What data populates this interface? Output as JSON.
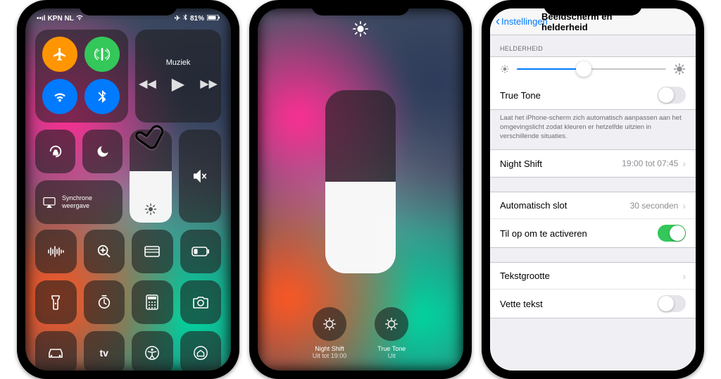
{
  "statusBar": {
    "carrier": "KPN NL",
    "battery": "81%"
  },
  "controlCenter": {
    "musicLabel": "Muziek",
    "syncLabel": "Synchrone weergave",
    "brightnessSliderPercent": 55
  },
  "brightnessPanel": {
    "sliderPercent": 50,
    "nightShift": {
      "title": "Night Shift",
      "subtitle": "Uit tot 19:00"
    },
    "trueTone": {
      "title": "True Tone",
      "subtitle": "Uit"
    }
  },
  "settings": {
    "backLabel": "Instellingen",
    "title": "Beeldscherm en helderheid",
    "brightnessHeader": "HELDERHEID",
    "trueTone": {
      "label": "True Tone",
      "on": false
    },
    "trueToneFootnote": "Laat het iPhone-scherm zich automatisch aanpassen aan het omgevingslicht zodat kleuren er hetzelfde uitzien in verschillende situaties.",
    "nightShift": {
      "label": "Night Shift",
      "value": "19:00 tot 07:45"
    },
    "autoLock": {
      "label": "Automatisch slot",
      "value": "30 seconden"
    },
    "raiseToWake": {
      "label": "Til op om te activeren",
      "on": true
    },
    "textSize": {
      "label": "Tekstgrootte"
    },
    "boldText": {
      "label": "Vette tekst",
      "on": false
    }
  }
}
